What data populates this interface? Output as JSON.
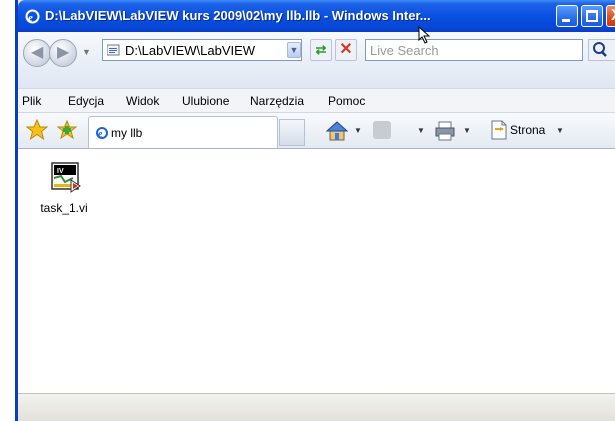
{
  "window": {
    "title": "D:\\LabVIEW\\LabVIEW kurs 2009\\02\\my llb.llb - Windows Inter...",
    "close_glyph": "X"
  },
  "address": {
    "path": "D:\\LabVIEW\\LabVIEW",
    "search_placeholder": "Live Search"
  },
  "menu": {
    "items": [
      "Plik",
      "Edycja",
      "Widok",
      "Ulubione",
      "Narzędzia",
      "Pomoc"
    ]
  },
  "toolbar": {
    "tab_label": "my llb",
    "page_label": "Strona"
  },
  "content": {
    "files": [
      {
        "name": "task_1.vi",
        "icon": "labview-vi-icon"
      }
    ]
  },
  "colors": {
    "titlebar": "#0a50e0",
    "frame": "#0a3cc4",
    "close_button": "#de4a1c"
  }
}
